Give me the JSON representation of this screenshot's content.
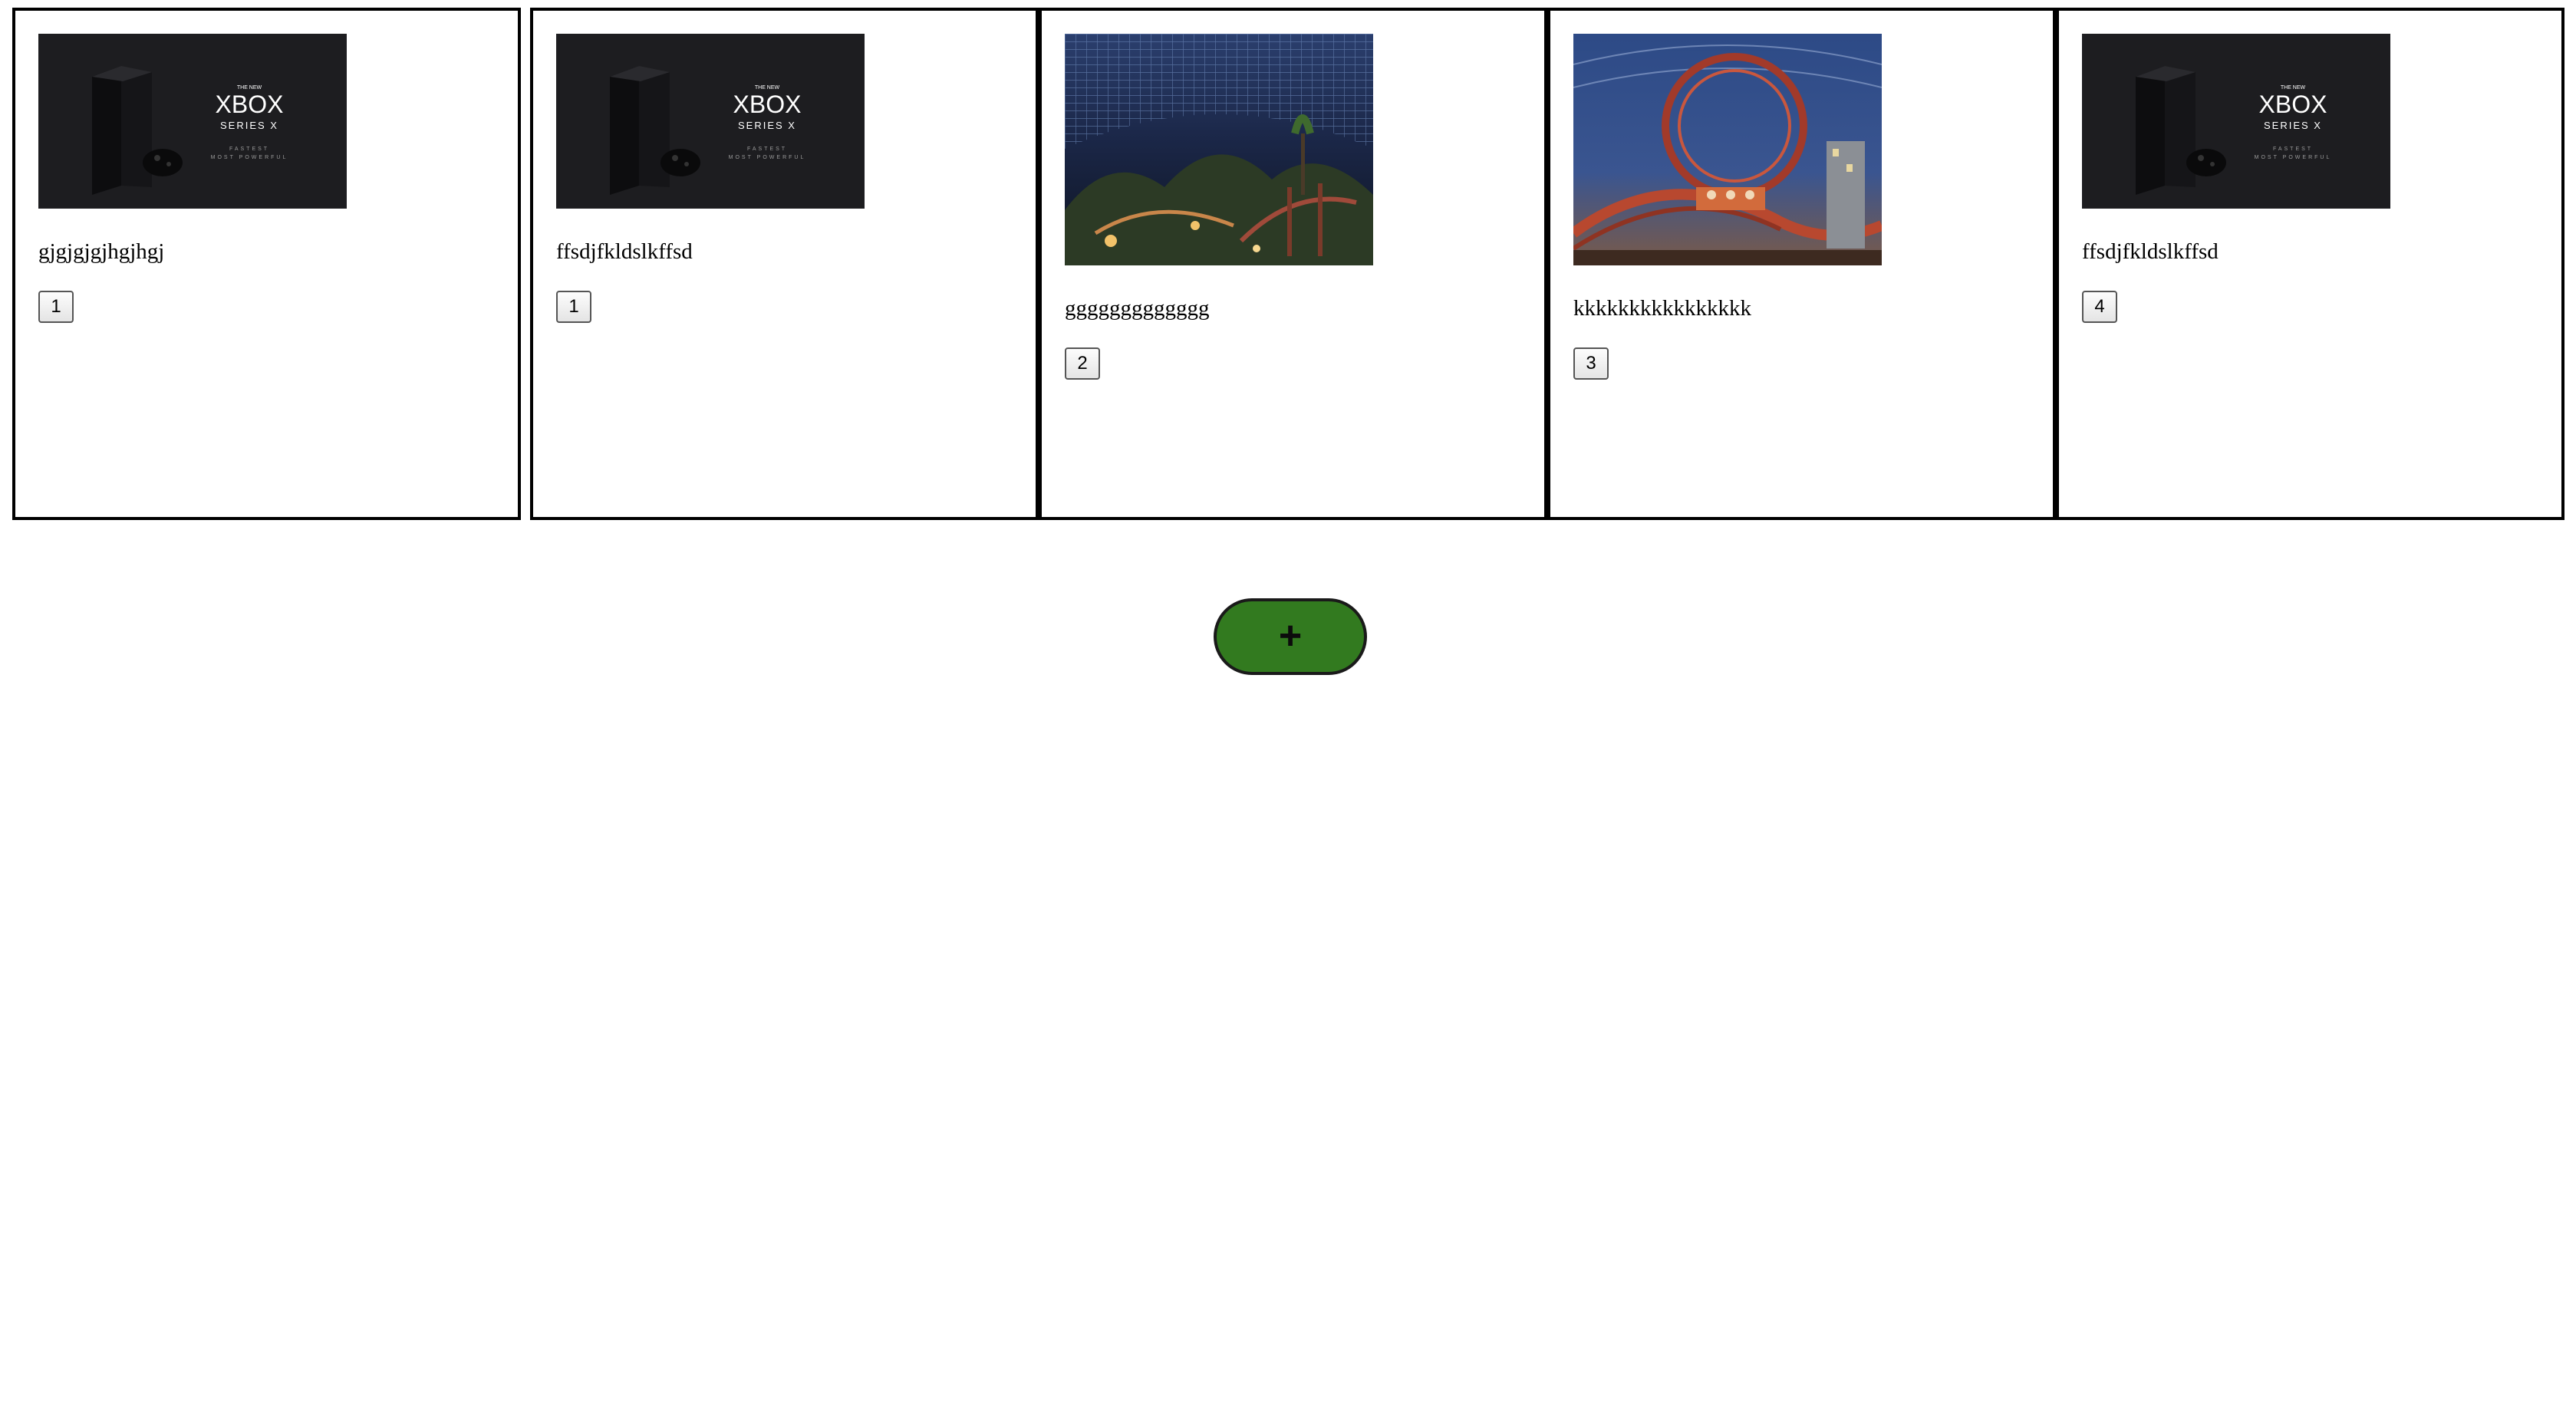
{
  "cards": [
    {
      "title": "gjgjgjgjhgjhgj",
      "count": "1",
      "image": "xbox-series-x-image"
    },
    {
      "title": "ffsdjfkldslkffsd",
      "count": "1",
      "image": "xbox-series-x-image"
    },
    {
      "title": "ggggggggggggg",
      "count": "2",
      "image": "indoor-theme-park-image"
    },
    {
      "title": "kkkkkkkkkkkkkkkk",
      "count": "3",
      "image": "roller-coaster-image"
    },
    {
      "title": "ffsdjfkldslkffsd",
      "count": "4",
      "image": "xbox-series-x-image"
    }
  ],
  "xbox_image": {
    "top_line": "THE NEW",
    "brand": "XBOX",
    "model": "SERIES X",
    "tag1": "FASTEST",
    "tag2": "MOST POWERFUL"
  },
  "add_button": {
    "label": "+"
  },
  "colors": {
    "add_button_bg": "#327a1f",
    "card_border": "#000000"
  }
}
